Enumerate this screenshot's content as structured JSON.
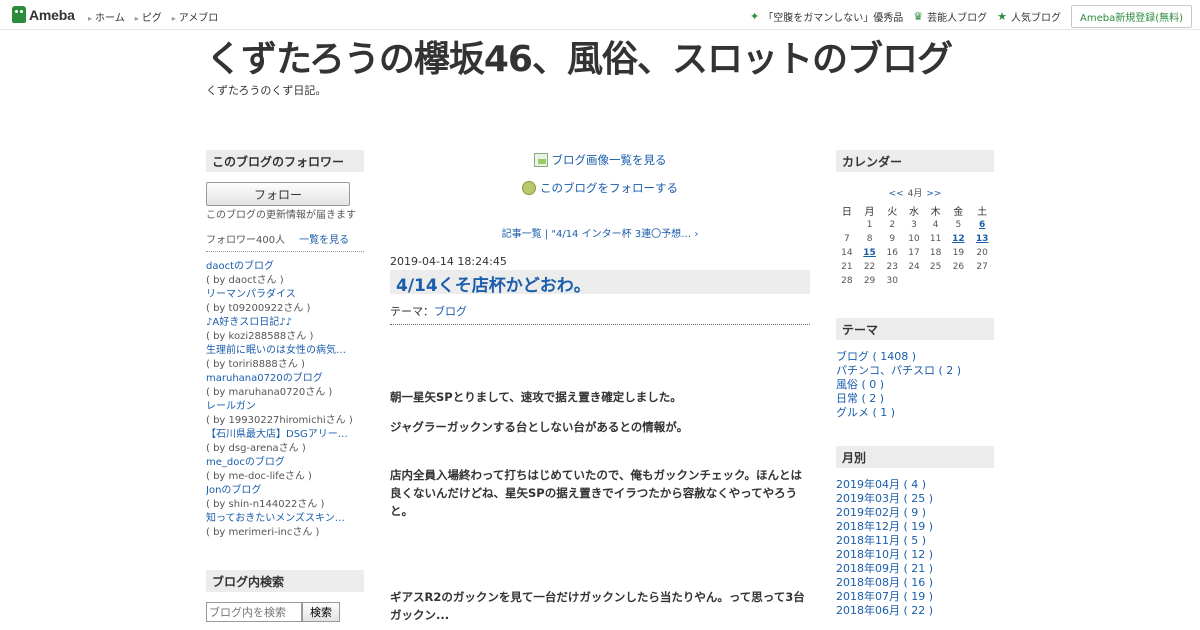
{
  "topbar": {
    "logo_text": "Ameba",
    "nav": [
      "ホーム",
      "ピグ",
      "アメブロ"
    ],
    "right": [
      {
        "label": "「空腹をガマンしない」優秀品",
        "icon": "green-cross-icon"
      },
      {
        "label": "芸能人ブログ",
        "icon": "crown-icon"
      },
      {
        "label": "人気ブログ",
        "icon": "star-icon"
      }
    ],
    "register_label": "Ameba新規登録(無料)"
  },
  "header": {
    "title": "くずたろうの欅坂46、風俗、スロットのブログ",
    "description": "くずたろうのくず日記。"
  },
  "followers": {
    "heading": "このブログのフォロワー",
    "follow_button": "フォロー",
    "description": "このブログの更新情報が届きます",
    "count_label": "フォロワー400人",
    "list_link": "一覧を見る",
    "items": [
      {
        "name": "daoctのブログ",
        "by": "( by daoctさん )"
      },
      {
        "name": "リーマンパラダイス",
        "by": "( by t09200922さん )"
      },
      {
        "name": "♪A好きスロ日記♪♪",
        "by": "( by kozi288588さん )"
      },
      {
        "name": "生理前に眠いのは女性の病気…",
        "by": "( by toriri8888さん )"
      },
      {
        "name": "maruhana0720のブログ",
        "by": "( by maruhana0720さん )"
      },
      {
        "name": "レールガン",
        "by": "( by 19930227hiromichiさん )"
      },
      {
        "name": "【石川県最大店】DSGアリー…",
        "by": "( by dsg-arenaさん )"
      },
      {
        "name": "me_docのブログ",
        "by": "( by me-doc-lifeさん )"
      },
      {
        "name": "Jonのブログ",
        "by": "( by shin-n144022さん )"
      },
      {
        "name": "知っておきたいメンズスキン…",
        "by": "( by merimeri-incさん )"
      }
    ]
  },
  "search": {
    "heading": "ブログ内検索",
    "placeholder": "ブログ内を検索",
    "button": "検索"
  },
  "center": {
    "image_list_link": "ブログ画像一覧を見る",
    "follow_link": "このブログをフォローする",
    "entry_nav": "記事一覧 | \"4/14 インター杯 3連〇予想…",
    "entry_date": "2019-04-14 18:24:45",
    "entry_title": "4/14くそ店杯かどおわ。",
    "theme_label": "テーマ：",
    "theme_value": "ブログ",
    "paragraphs": [
      "朝一星矢SPとりまして、速攻で据え置き確定しました。",
      "ジャグラーガックンする台としない台があるとの情報が。",
      "店内全員入場終わって打ちはじめていたので、俺もガックンチェック。ほんとは良くないんだけどね、星矢SPの据え置きでイラつたから容赦なくやってやろうと。",
      "ギアスR2のガックンを見て一台だけガックンしたら当たりやん。って思って3台ガックン..."
    ]
  },
  "calendar": {
    "heading": "カレンダー",
    "prev": "<<",
    "month": "4月",
    "next": ">>",
    "weekdays": [
      "日",
      "月",
      "火",
      "水",
      "木",
      "金",
      "土"
    ],
    "weeks": [
      [
        "",
        "1",
        "2",
        "3",
        "4",
        "5",
        "6"
      ],
      [
        "7",
        "8",
        "9",
        "10",
        "11",
        "12",
        "13"
      ],
      [
        "14",
        "15",
        "16",
        "17",
        "18",
        "19",
        "20"
      ],
      [
        "21",
        "22",
        "23",
        "24",
        "25",
        "26",
        "27"
      ],
      [
        "28",
        "29",
        "30",
        "",
        "",
        "",
        ""
      ]
    ],
    "linked_days": [
      "6",
      "12",
      "13",
      "15"
    ]
  },
  "themes": {
    "heading": "テーマ",
    "items": [
      "ブログ ( 1408 )",
      "パチンコ、パチスロ ( 2 )",
      "風俗 ( 0 )",
      "日常 ( 2 )",
      "グルメ ( 1 )"
    ]
  },
  "archives": {
    "heading": "月別",
    "items": [
      "2019年04月 ( 4 )",
      "2019年03月 ( 25 )",
      "2019年02月 ( 9 )",
      "2018年12月 ( 19 )",
      "2018年11月 ( 5 )",
      "2018年10月 ( 12 )",
      "2018年09月 ( 21 )",
      "2018年08月 ( 16 )",
      "2018年07月 ( 19 )",
      "2018年06月 ( 22 )"
    ]
  }
}
